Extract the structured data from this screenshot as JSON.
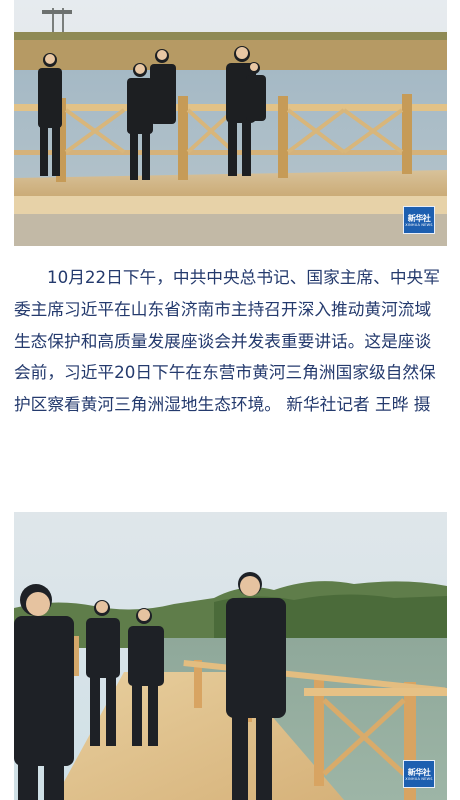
{
  "article": {
    "caption": "10月22日下午，中共中央总书记、国家主席、中央军委主席习近平在山东省济南市主持召开深入推动黄河流域生态保护和高质量发展座谈会并发表重要讲话。这是座谈会前，习近平20日下午在东营市黄河三角洲国家级自然保护区察看黄河三角洲湿地生态环境。 新华社记者 王晔 摄"
  },
  "photos": [
    {
      "logo_cn": "新华社",
      "logo_en": "XINHUA NEWS"
    },
    {
      "logo_cn": "新华社",
      "logo_en": "XINHUA NEWS"
    }
  ],
  "colors": {
    "caption_text": "#243a6d",
    "logo_bg": "#1d5fb0",
    "water": "#9fb7c6",
    "boardwalk_wood": "#d9b77a",
    "sky": "#e9eef2"
  }
}
